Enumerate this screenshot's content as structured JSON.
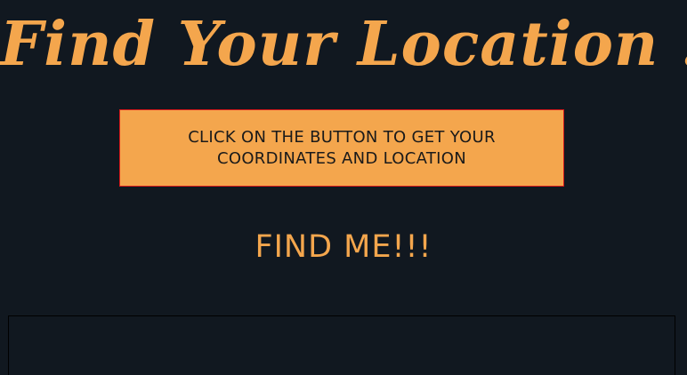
{
  "header": {
    "title": "Find Your Location !"
  },
  "instruction": {
    "text": "CLICK ON THE BUTTON TO GET YOUR COORDINATES AND LOCATION"
  },
  "action": {
    "find_me_label": "FIND ME!!!"
  },
  "colors": {
    "background": "#111820",
    "accent": "#f4a64d",
    "instruction_border": "#d81a1a",
    "instruction_text": "#1a1a1a"
  }
}
